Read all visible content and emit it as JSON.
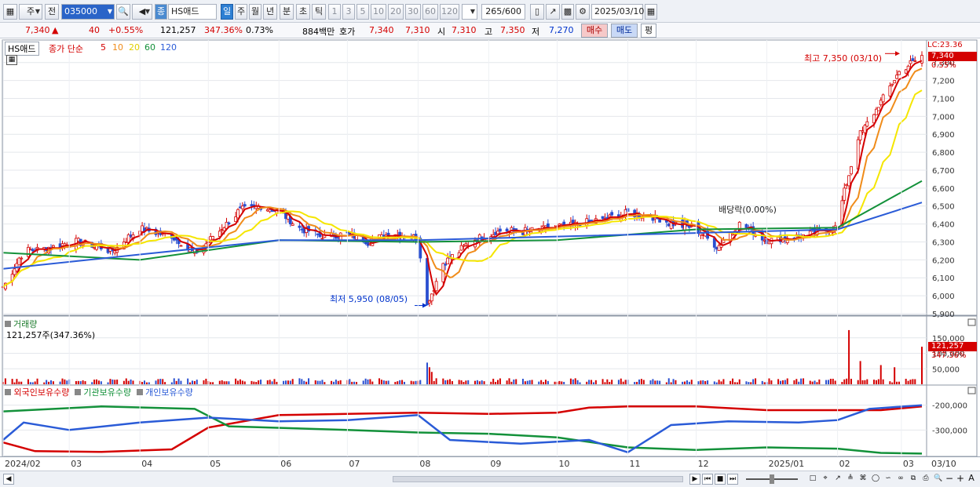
{
  "toolbar": {
    "mode_label": "주",
    "prev_label": "전",
    "code_value": "035000",
    "stock_badge": "종",
    "stock_name": "HS애드",
    "periods": [
      "일",
      "주",
      "월",
      "년",
      "분",
      "초",
      "틱"
    ],
    "active_period": "일",
    "intervals": [
      "1",
      "3",
      "5",
      "10",
      "20",
      "30",
      "60",
      "120"
    ],
    "count_value": "265",
    "count_total": "/600",
    "date_value": "2025/03/10"
  },
  "quote": {
    "price": "7,340",
    "change_arrow": "▲",
    "change": "40",
    "change_pct": "+0.55%",
    "volume": "121,257",
    "vol_ratio": "347.36%",
    "turnover": "0.73%",
    "amount": "884백만",
    "hoga_label": "호가",
    "ask": "7,340",
    "bid": "7,310",
    "open_label": "시",
    "open": "7,310",
    "high_label": "고",
    "high": "7,350",
    "low_label": "저",
    "low": "7,270",
    "buy_label": "매수",
    "sell_label": "매도",
    "even_label": "평"
  },
  "price_pane": {
    "title": "HS애드",
    "legend_prefix": "종가 단순",
    "ma_periods": [
      "5",
      "10",
      "20",
      "60",
      "120"
    ],
    "ma_colors": [
      "#d40000",
      "#f08c1a",
      "#f5e600",
      "#13913a",
      "#2a5bd7"
    ],
    "lc_label": "LC:23.36",
    "last_price_tag": "7,340",
    "last_pct_tag": "0.55%",
    "high_annotation": "최고 7,350 (03/10)",
    "low_annotation": "최저 5,950 (08/05)",
    "dividend_annotation": "배당락(0.00%)"
  },
  "volume_pane": {
    "title": "거래량",
    "summary": "121,257주(347.36%)",
    "last_tag": "121,257",
    "last_pct": "347.36%"
  },
  "holdings_pane": {
    "legend": [
      "외국인보유수량",
      "기관보유수량",
      "개인보유수량"
    ],
    "colors": [
      "#d40000",
      "#13913a",
      "#2a5bd7"
    ]
  },
  "chart_data": [
    {
      "type": "candlestick",
      "title": "HS애드",
      "x_range": [
        "2024/02",
        "2025/03/10"
      ],
      "x_ticks": [
        "2024/02",
        "03",
        "04",
        "05",
        "06",
        "07",
        "08",
        "09",
        "10",
        "11",
        "12",
        "2025/01",
        "02",
        "03",
        "03/10"
      ],
      "ylim": [
        5900,
        7360
      ],
      "y_ticks": [
        5900,
        6000,
        6100,
        6200,
        6300,
        6400,
        6500,
        6600,
        6700,
        6800,
        6900,
        7000,
        7100,
        7200,
        7300
      ],
      "close_points": [
        [
          "2024-02-01",
          6050
        ],
        [
          "2024-02-10",
          6250
        ],
        [
          "2024-02-25",
          6280
        ],
        [
          "2024-03-05",
          6300
        ],
        [
          "2024-03-20",
          6250
        ],
        [
          "2024-04-01",
          6380
        ],
        [
          "2024-04-15",
          6330
        ],
        [
          "2024-04-25",
          6240
        ],
        [
          "2024-05-05",
          6350
        ],
        [
          "2024-05-15",
          6480
        ],
        [
          "2024-05-25",
          6500
        ],
        [
          "2024-06-01",
          6470
        ],
        [
          "2024-06-10",
          6380
        ],
        [
          "2024-06-20",
          6330
        ],
        [
          "2024-07-01",
          6340
        ],
        [
          "2024-07-10",
          6300
        ],
        [
          "2024-07-20",
          6350
        ],
        [
          "2024-08-01",
          6320
        ],
        [
          "2024-08-05",
          5950
        ],
        [
          "2024-08-12",
          6180
        ],
        [
          "2024-08-25",
          6310
        ],
        [
          "2024-09-05",
          6360
        ],
        [
          "2024-09-20",
          6360
        ],
        [
          "2024-10-05",
          6390
        ],
        [
          "2024-10-20",
          6420
        ],
        [
          "2024-11-01",
          6460
        ],
        [
          "2024-11-10",
          6450
        ],
        [
          "2024-11-20",
          6400
        ],
        [
          "2024-12-01",
          6380
        ],
        [
          "2024-12-10",
          6270
        ],
        [
          "2024-12-20",
          6400
        ],
        [
          "2025-01-01",
          6310
        ],
        [
          "2025-01-15",
          6330
        ],
        [
          "2025-01-31",
          6380
        ],
        [
          "2025-02-10",
          6880
        ],
        [
          "2025-02-20",
          7080
        ],
        [
          "2025-02-28",
          7250
        ],
        [
          "2025-03-10",
          7340
        ]
      ],
      "moving_averages": [
        {
          "name": "5",
          "color": "#d40000"
        },
        {
          "name": "10",
          "color": "#f08c1a"
        },
        {
          "name": "20",
          "color": "#f5e600"
        },
        {
          "name": "60",
          "color": "#13913a",
          "points": [
            [
              "2024-02-01",
              6240
            ],
            [
              "2024-04-01",
              6200
            ],
            [
              "2024-06-01",
              6310
            ],
            [
              "2024-08-01",
              6300
            ],
            [
              "2024-10-01",
              6310
            ],
            [
              "2024-12-01",
              6370
            ],
            [
              "2025-02-01",
              6380
            ],
            [
              "2025-03-10",
              6640
            ]
          ]
        },
        {
          "name": "120",
          "color": "#2a5bd7",
          "points": [
            [
              "2024-02-01",
              6150
            ],
            [
              "2024-04-01",
              6230
            ],
            [
              "2024-06-01",
              6310
            ],
            [
              "2024-08-01",
              6310
            ],
            [
              "2024-10-01",
              6330
            ],
            [
              "2024-12-01",
              6350
            ],
            [
              "2025-02-01",
              6370
            ],
            [
              "2025-03-10",
              6520
            ]
          ]
        }
      ],
      "annotations": [
        {
          "text": "최고 7,350 (03/10)",
          "x": "2025-03-10",
          "y": 7350
        },
        {
          "text": "최저 5,950 (08/05)",
          "x": "2024-08-05",
          "y": 5950
        },
        {
          "text": "배당락(0.00%)",
          "x": "2024-12-15",
          "y": 6450
        }
      ]
    },
    {
      "type": "bar",
      "title": "거래량",
      "y_ticks": [
        50000,
        100000,
        150000
      ],
      "ylim": [
        0,
        190000
      ],
      "typical_volume": 15000,
      "spikes": [
        [
          "2024-08-05",
          70000
        ],
        [
          "2024-08-06",
          55000
        ],
        [
          "2024-08-07",
          40000
        ],
        [
          "2025-02-06",
          175000
        ],
        [
          "2025-02-11",
          75000
        ],
        [
          "2025-02-20",
          62000
        ],
        [
          "2025-02-26",
          55000
        ],
        [
          "2025-03-10",
          121257
        ]
      ]
    },
    {
      "type": "line",
      "title": "보유수량",
      "y_ticks": [
        -200000,
        -300000
      ],
      "ylim": [
        -400000,
        -160000
      ],
      "series": [
        {
          "name": "외국인보유수량",
          "color": "#d40000",
          "points": [
            [
              "2024-02-01",
              -350000
            ],
            [
              "2024-02-15",
              -385000
            ],
            [
              "2024-03-15",
              -388000
            ],
            [
              "2024-04-15",
              -378000
            ],
            [
              "2024-05-01",
              -290000
            ],
            [
              "2024-06-01",
              -240000
            ],
            [
              "2024-07-01",
              -235000
            ],
            [
              "2024-08-01",
              -230000
            ],
            [
              "2024-09-01",
              -235000
            ],
            [
              "2024-10-01",
              -230000
            ],
            [
              "2024-10-15",
              -210000
            ],
            [
              "2024-11-01",
              -205000
            ],
            [
              "2024-12-01",
              -205000
            ],
            [
              "2025-01-01",
              -220000
            ],
            [
              "2025-02-01",
              -220000
            ],
            [
              "2025-02-20",
              -220000
            ],
            [
              "2025-03-10",
              -205000
            ]
          ]
        },
        {
          "name": "기관보유수량",
          "color": "#13913a",
          "points": [
            [
              "2024-02-01",
              -225000
            ],
            [
              "2024-03-15",
              -205000
            ],
            [
              "2024-04-25",
              -215000
            ],
            [
              "2024-05-10",
              -285000
            ],
            [
              "2024-07-01",
              -300000
            ],
            [
              "2024-08-01",
              -310000
            ],
            [
              "2024-09-01",
              -315000
            ],
            [
              "2024-10-01",
              -330000
            ],
            [
              "2024-11-01",
              -370000
            ],
            [
              "2024-12-01",
              -380000
            ],
            [
              "2025-01-01",
              -370000
            ],
            [
              "2025-02-01",
              -375000
            ],
            [
              "2025-02-20",
              -392000
            ],
            [
              "2025-03-10",
              -395000
            ]
          ]
        },
        {
          "name": "개인보유수량",
          "color": "#2a5bd7",
          "points": [
            [
              "2024-02-01",
              -340000
            ],
            [
              "2024-02-10",
              -270000
            ],
            [
              "2024-03-01",
              -300000
            ],
            [
              "2024-04-01",
              -270000
            ],
            [
              "2024-05-01",
              -250000
            ],
            [
              "2024-06-01",
              -265000
            ],
            [
              "2024-07-01",
              -260000
            ],
            [
              "2024-08-01",
              -240000
            ],
            [
              "2024-08-15",
              -340000
            ],
            [
              "2024-09-15",
              -355000
            ],
            [
              "2024-10-15",
              -340000
            ],
            [
              "2024-11-01",
              -390000
            ],
            [
              "2024-11-20",
              -280000
            ],
            [
              "2024-12-15",
              -265000
            ],
            [
              "2025-01-15",
              -270000
            ],
            [
              "2025-02-01",
              -260000
            ],
            [
              "2025-02-15",
              -215000
            ],
            [
              "2025-03-10",
              -200000
            ]
          ]
        }
      ]
    }
  ]
}
